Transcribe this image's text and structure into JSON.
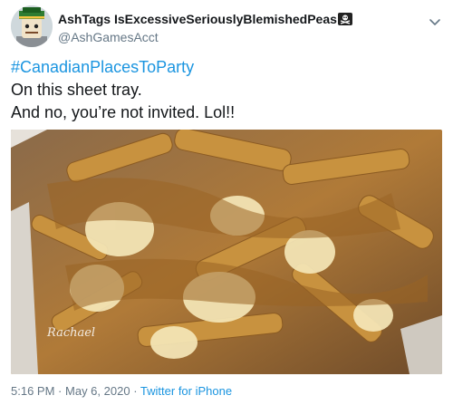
{
  "author": {
    "display_name": "AshTags IsExcessiveSeriouslyBlemishedPeas",
    "handle": "@AshGamesAcct",
    "avatar_icon": "cartoon-avatar-icon",
    "name_emoji_icon": "pirate-flag-icon"
  },
  "tweet": {
    "hashtag": "#CanadianPlacesToParty",
    "line1": "On this sheet tray.",
    "line2": "And no, you’re not invited. Lol!!",
    "link_color": "#1b95e0"
  },
  "media": {
    "watermark": "Rachael"
  },
  "footer": {
    "time": "5:16 PM",
    "sep1": "·",
    "date": "May 6, 2020",
    "sep2": "·",
    "source": "Twitter for iPhone"
  }
}
